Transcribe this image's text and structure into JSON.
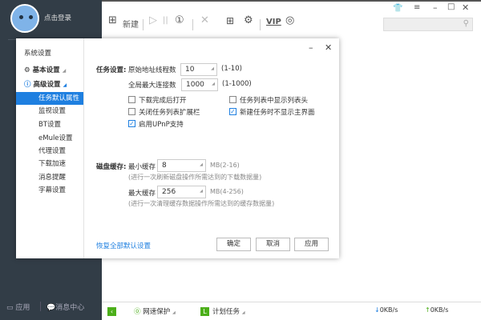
{
  "user": {
    "login_label": "点击登录"
  },
  "toolbar": {
    "new_label": "新建",
    "vip_label": "VIP"
  },
  "left_bottom": {
    "apps_label": "应用",
    "messages_label": "消息中心"
  },
  "dialog": {
    "sidebar": {
      "title": "系统设置",
      "groups": [
        {
          "label": "基本设置"
        },
        {
          "label": "高级设置"
        }
      ],
      "items": [
        {
          "label": "任务默认属性",
          "selected": true
        },
        {
          "label": "监视设置"
        },
        {
          "label": "BT设置"
        },
        {
          "label": "eMule设置"
        },
        {
          "label": "代理设置"
        },
        {
          "label": "下载加速"
        },
        {
          "label": "消息提醒"
        },
        {
          "label": "字幕设置"
        }
      ]
    },
    "task": {
      "section_label": "任务设置:",
      "threads_label": "原始地址线程数",
      "threads_value": "10",
      "threads_range": "(1-10)",
      "conn_label": "全局最大连接数",
      "conn_value": "1000",
      "conn_range": "(1-1000)",
      "checkboxes": [
        {
          "label": "下载完成后打开",
          "checked": false
        },
        {
          "label": "任务列表中显示列表头",
          "checked": false
        },
        {
          "label": "关闭任务列表扩展栏",
          "checked": false
        },
        {
          "label": "新建任务时不显示主界面",
          "checked": true
        },
        {
          "label": "启用UPnP支持",
          "checked": true
        }
      ]
    },
    "cache": {
      "section_label": "磁盘缓存:",
      "min_label": "最小缓存",
      "min_value": "8",
      "min_range": "MB(2-16)",
      "min_note": "(进行一次刷新磁盘操作所需达到的下载数据量)",
      "max_label": "最大缓存",
      "max_value": "256",
      "max_range": "MB(4-256)",
      "max_note": "(进行一次清理缓存数据操作所需达到的缓存数据量)"
    },
    "footer": {
      "restore_label": "恢复全部默认设置",
      "ok_label": "确定",
      "cancel_label": "取消",
      "apply_label": "应用"
    }
  },
  "status": {
    "protect_label": "网速保护",
    "schedule_label": "计划任务",
    "down_speed": "0KB/s",
    "up_speed": "0KB/s"
  },
  "colors": {
    "accent": "#1e7fe0",
    "sidebar_bg": "#323d47",
    "green": "#4caf1a"
  }
}
